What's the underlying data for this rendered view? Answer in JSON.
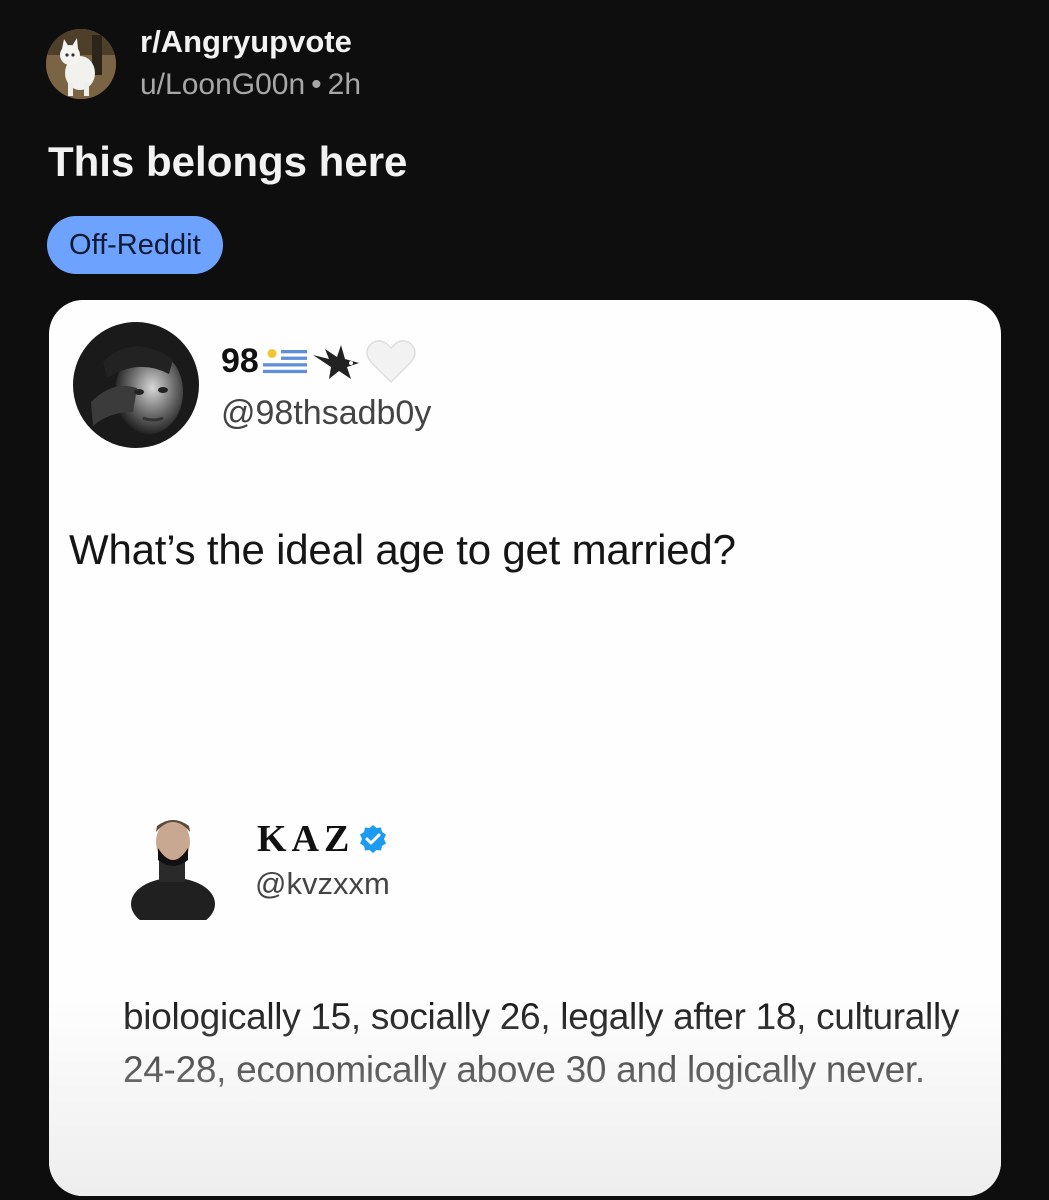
{
  "post": {
    "subreddit": "r/Angryupvote",
    "author": "u/LoonG00n",
    "separator": "•",
    "age": "2h",
    "title": "This belongs here",
    "flair": "Off-Reddit",
    "subreddit_icon": "cat-avatar-icon"
  },
  "image": {
    "tweet": {
      "display_name": "98",
      "handle": "@98thsadb0y",
      "name_icons": [
        "uruguay-flag-icon",
        "eagle-icon",
        "white-heart-icon"
      ],
      "text": "What’s the ideal age to get married?"
    },
    "reply": {
      "display_name": "KAZ",
      "verified_icon": "verified-badge-icon",
      "handle": "@kvzxxm",
      "text": "biologically 15, socially 26, legally after 18, culturally 24-28, economically above 30 and logically never."
    }
  },
  "colors": {
    "background": "#0e0e0e",
    "flair_background": "#6da3ff",
    "card_background": "#fefefe",
    "verified_blue": "#1d9bf0"
  }
}
